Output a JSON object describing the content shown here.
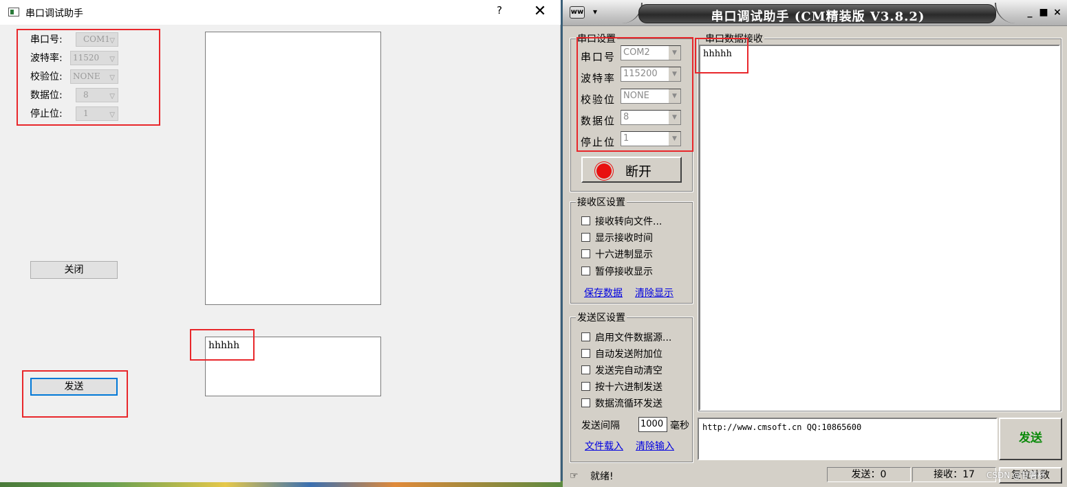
{
  "left_window": {
    "title": "串口调试助手",
    "help_glyph": "?",
    "close_glyph": "✕",
    "fields": [
      {
        "label": "串口号:",
        "value": "COM1"
      },
      {
        "label": "波特率:",
        "value": "11520"
      },
      {
        "label": "校验位:",
        "value": "NONE"
      },
      {
        "label": "数据位:",
        "value": "8"
      },
      {
        "label": "停止位:",
        "value": "1"
      }
    ],
    "close_button": "关闭",
    "send_button": "发送",
    "send_text": "hhhhh",
    "receive_text": ""
  },
  "right_window": {
    "title": "串口调试助手 (CM精装版 V3.8.2)",
    "window_controls": {
      "minimize": "_",
      "maximize": "■",
      "close": "×"
    },
    "serial_settings": {
      "group_title": "串口设置",
      "fields": [
        {
          "label": "串口号",
          "value": "COM2"
        },
        {
          "label": "波特率",
          "value": "115200"
        },
        {
          "label": "校验位",
          "value": "NONE"
        },
        {
          "label": "数据位",
          "value": "8"
        },
        {
          "label": "停止位",
          "value": "1"
        }
      ],
      "disconnect_button": "断开"
    },
    "receive_settings": {
      "group_title": "接收区设置",
      "options": [
        "接收转向文件...",
        "显示接收时间",
        "十六进制显示",
        "暂停接收显示"
      ],
      "links": [
        "保存数据",
        "清除显示"
      ]
    },
    "send_settings": {
      "group_title": "发送区设置",
      "options": [
        "启用文件数据源...",
        "自动发送附加位",
        "发送完自动清空",
        "按十六进制发送",
        "数据流循环发送"
      ],
      "interval_label": "发送间隔",
      "interval_value": "1000",
      "interval_unit": "毫秒",
      "links": [
        "文件载入",
        "清除输入"
      ]
    },
    "receive_area": {
      "group_title": "串口数据接收",
      "content": "hhhhh"
    },
    "send_area": {
      "content": "http://www.cmsoft.cn QQ:10865600"
    },
    "send_button": "发送",
    "status": {
      "ready": "就绪!",
      "sent": "发送：0",
      "received": "接收：17",
      "reset_button": "复位计数",
      "watermark": "CSDN @甘薯杆"
    }
  }
}
